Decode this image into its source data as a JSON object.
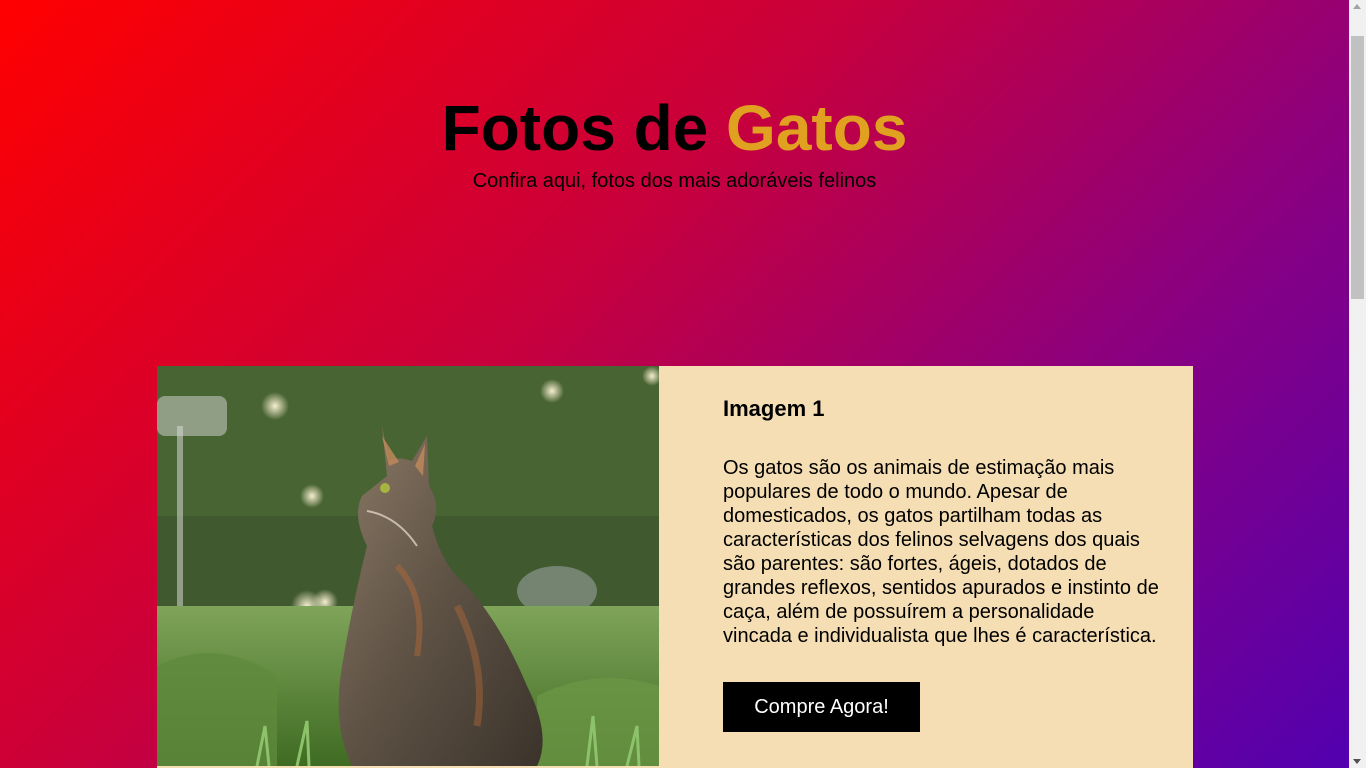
{
  "header": {
    "title_main": "Fotos de ",
    "title_accent": "Gatos",
    "subtitle": "Confira aqui, fotos dos mais adoráveis felinos"
  },
  "card": {
    "image_icon": "cat-photo",
    "heading": "Imagem 1",
    "text": "Os gatos são os animais de estimação mais populares de todo o mundo. Apesar de domesticados, os gatos partilham todas as características dos felinos selvagens dos quais são parentes: são fortes, ágeis, dotados de grandes reflexos, sentidos apurados e instinto de caça, além de possuírem a personalidade vincada e individualista que lhes é característica.",
    "button_label": "Compre Agora!"
  },
  "colors": {
    "background_gradient_start": "#ff0000",
    "background_gradient_end": "#5200b0",
    "accent": "#e0a020",
    "card_background": "#f5deb3",
    "button_background": "#000000"
  }
}
